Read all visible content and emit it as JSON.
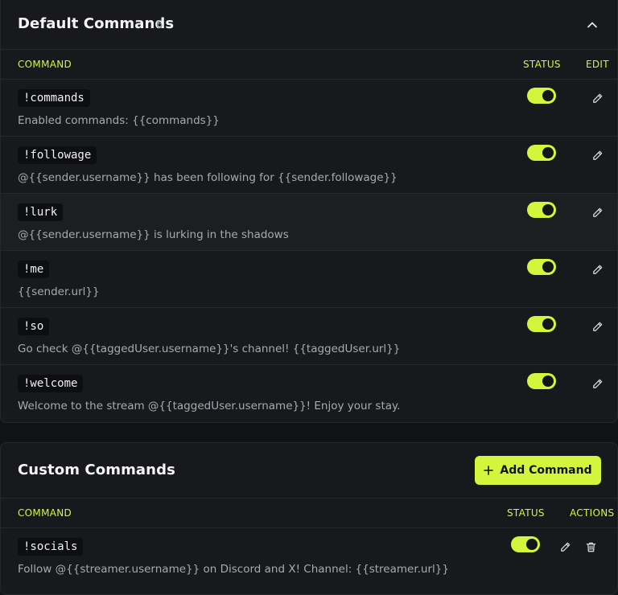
{
  "default_commands": {
    "title": "Default Commands",
    "count": "6",
    "columns": {
      "command": "COMMAND",
      "status": "STATUS",
      "edit": "EDIT"
    },
    "rows": [
      {
        "command": "!commands",
        "description": "Enabled commands: {{commands}}",
        "enabled": true
      },
      {
        "command": "!followage",
        "description": "@{{sender.username}} has been following for {{sender.followage}}",
        "enabled": true
      },
      {
        "command": "!lurk",
        "description": "@{{sender.username}} is lurking in the shadows",
        "enabled": true
      },
      {
        "command": "!me",
        "description": "{{sender.url}}",
        "enabled": true
      },
      {
        "command": "!so",
        "description": "Go check @{{taggedUser.username}}'s channel! {{taggedUser.url}}",
        "enabled": true
      },
      {
        "command": "!welcome",
        "description": "Welcome to the stream @{{taggedUser.username}}! Enjoy your stay.",
        "enabled": true
      }
    ]
  },
  "custom_commands": {
    "title": "Custom Commands",
    "add_button_label": "Add Command",
    "columns": {
      "command": "COMMAND",
      "status": "STATUS",
      "actions": "ACTIONS"
    },
    "rows": [
      {
        "command": "!socials",
        "description": "Follow @{{streamer.username}} on Discord and X! Channel: {{streamer.url}}",
        "enabled": true
      }
    ]
  },
  "colors": {
    "accent": "#d4f53c",
    "panel": "#18191c",
    "background": "#111214"
  },
  "icons": {
    "collapse": "chevron-up-icon",
    "edit": "pencil-icon",
    "delete": "trash-icon",
    "add": "plus-icon"
  }
}
